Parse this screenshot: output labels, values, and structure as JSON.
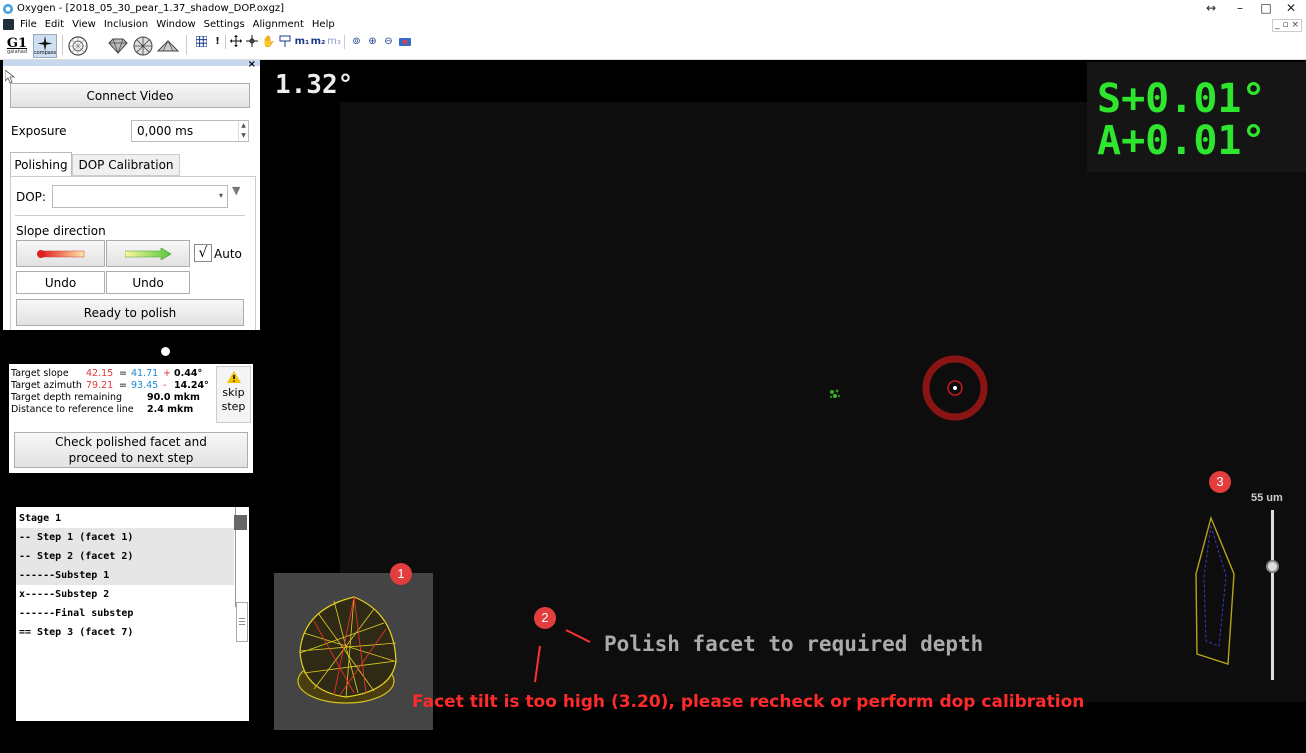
{
  "window": {
    "title": "Oxygen - [2018_05_30_pear_1.37_shadow_DOP.oxgz]",
    "controls": {
      "restore": "↔",
      "minimize": "–",
      "maximize": "□",
      "close": "✕"
    },
    "mdi_controls": "_ ▫ ×"
  },
  "menu": [
    "File",
    "Edit",
    "View",
    "Inclusion",
    "Window",
    "Settings",
    "Alignment",
    "Help"
  ],
  "toolbar": {
    "g1_label": "G1",
    "g1_sub": "galahad",
    "compass_sub": "compass",
    "m_labels": [
      "m₁",
      "m₂",
      "m₃"
    ]
  },
  "left_panel": {
    "close": "×",
    "connect_video": "Connect Video",
    "exposure_label": "Exposure",
    "exposure_value": "0,000 ms",
    "tabs": [
      "Polishing",
      "DOP Calibration"
    ],
    "dop_label": "DOP:",
    "slope_direction": "Slope direction",
    "auto_label": "Auto",
    "auto_checked": true,
    "undo1": "Undo",
    "undo2": "Undo",
    "ready": "Ready to polish"
  },
  "target_panel": {
    "rows": [
      {
        "label": "Target slope",
        "a": "42.15",
        "eq": "=",
        "b": "41.71",
        "op": "+",
        "c": "0.44°"
      },
      {
        "label": "Target azimuth",
        "a": "79.21",
        "eq": "=",
        "b": "93.45",
        "op": "-",
        "c": "14.24°"
      },
      {
        "label": "Target depth remaining",
        "value": "90.0 mkm"
      },
      {
        "label": "Distance to reference line",
        "value": "2.4 mkm"
      }
    ],
    "skip": "skip",
    "step": "step",
    "check_line1": "Check polished facet and",
    "check_line2": "proceed to next step"
  },
  "steps_list": [
    {
      "text": "Stage 1",
      "hl": false
    },
    {
      "text": "-- Step 1 (facet 1)",
      "hl": true
    },
    {
      "text": "-- Step 2 (facet 2)",
      "hl": true
    },
    {
      "text": "------Substep 1",
      "hl": true
    },
    {
      "text": "x-----Substep 2",
      "hl": false
    },
    {
      "text": "------Final substep",
      "hl": false
    },
    {
      "text": "== Step 3 (facet 7)",
      "hl": false
    }
  ],
  "video": {
    "angle": "1.32°",
    "slope_offset": "S+0.01°",
    "azimuth_offset": "A+0.01°",
    "scale_label": "55 um",
    "hint": "Polish facet to required depth",
    "warning": "Facet tilt is too high (3.20), please recheck or perform dop calibration",
    "badges": [
      "1",
      "2",
      "3"
    ]
  },
  "colors": {
    "green_readout": "#2ee62e",
    "warning_red": "#ff2a2a",
    "slope_red": "#e03a3a",
    "slope_blue": "#1a8ad4",
    "badge": "#e43d3d"
  }
}
